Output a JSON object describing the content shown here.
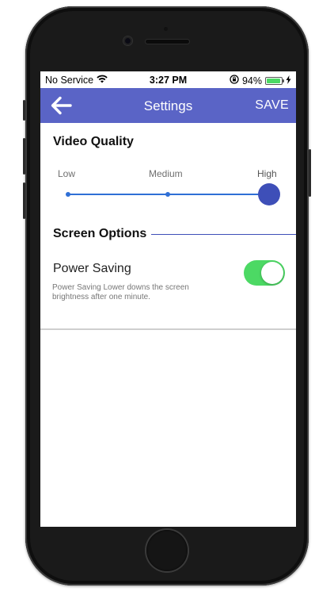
{
  "status_bar": {
    "carrier": "No Service",
    "time": "3:27 PM",
    "battery_percent": "94%",
    "battery_level": 0.94,
    "icons": [
      "wifi-icon",
      "orientation-lock-icon",
      "battery-icon",
      "charging-bolt-icon"
    ]
  },
  "navbar": {
    "title": "Settings",
    "save_label": "SAVE",
    "back_icon": "arrow-left-icon",
    "color": "#5a64c6"
  },
  "video_quality": {
    "title": "Video Quality",
    "options": [
      "Low",
      "Medium",
      "High"
    ],
    "selected": "High",
    "accent": "#3e4fb8"
  },
  "screen_options": {
    "title": "Screen Options",
    "power_saving": {
      "label": "Power Saving",
      "description": "Power Saving Lower downs the screen brightness after one minute.",
      "enabled": true,
      "toggle_color": "#4cd964"
    }
  }
}
